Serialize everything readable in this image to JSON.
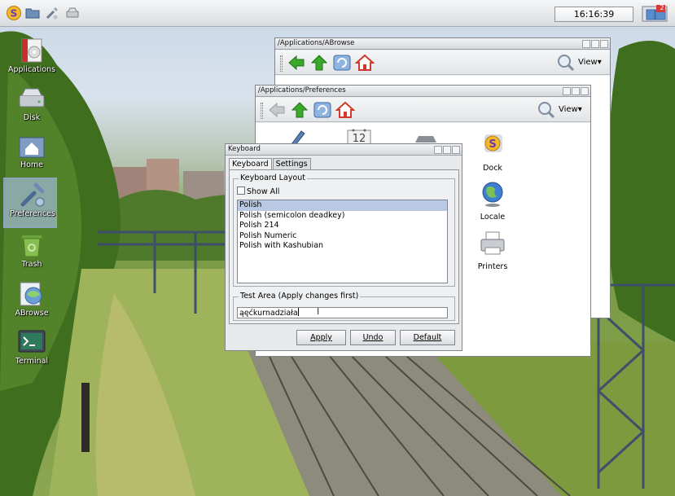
{
  "panel": {
    "clock": "16:16:39",
    "pager_badge": "2",
    "launchers": [
      "smeegol-logo-icon",
      "folder-icon",
      "preferences-icon",
      "drive-icon"
    ]
  },
  "desktop_icons": [
    {
      "name": "Applications",
      "icon": "applications-icon"
    },
    {
      "name": "Disk",
      "icon": "disk-icon"
    },
    {
      "name": "Home",
      "icon": "home-icon"
    },
    {
      "name": "Preferences",
      "icon": "preferences-icon"
    },
    {
      "name": "Trash",
      "icon": "trash-icon"
    },
    {
      "name": "ABrowse",
      "icon": "abrowse-icon"
    },
    {
      "name": "Terminal",
      "icon": "terminal-icon"
    }
  ],
  "windows": {
    "abrowse": {
      "title": "/Applications/ABrowse",
      "view_label": "View"
    },
    "prefs": {
      "title": "/Applications/Preferences",
      "view_label": "View",
      "calendar_day": "12",
      "items": [
        {
          "label": "Dock",
          "icon": "dock-icon"
        },
        {
          "label": "Locale",
          "icon": "globe-icon"
        },
        {
          "label": "Printers",
          "icon": "printer-icon"
        }
      ]
    },
    "keyboard": {
      "title": "Keyboard",
      "tabs": [
        "Keyboard",
        "Settings"
      ],
      "layout_group": "Keyboard Layout",
      "show_all": "Show All",
      "layouts": [
        "Polish",
        "Polish (semicolon deadkey)",
        "Polish 214",
        "Polish Numeric",
        "Polish with Kashubian"
      ],
      "selected_layout": "Polish",
      "test_group": "Test Area (Apply changes first)",
      "test_value": "ąęćkurnadziała",
      "buttons": {
        "apply": "Apply",
        "undo": "Undo",
        "default": "Default"
      }
    }
  },
  "colors": {
    "selection": "#b9c9e3",
    "sky": "#c9d7e6",
    "foliage": "#3f6e1e",
    "arrow_green": "#3aa82b"
  }
}
